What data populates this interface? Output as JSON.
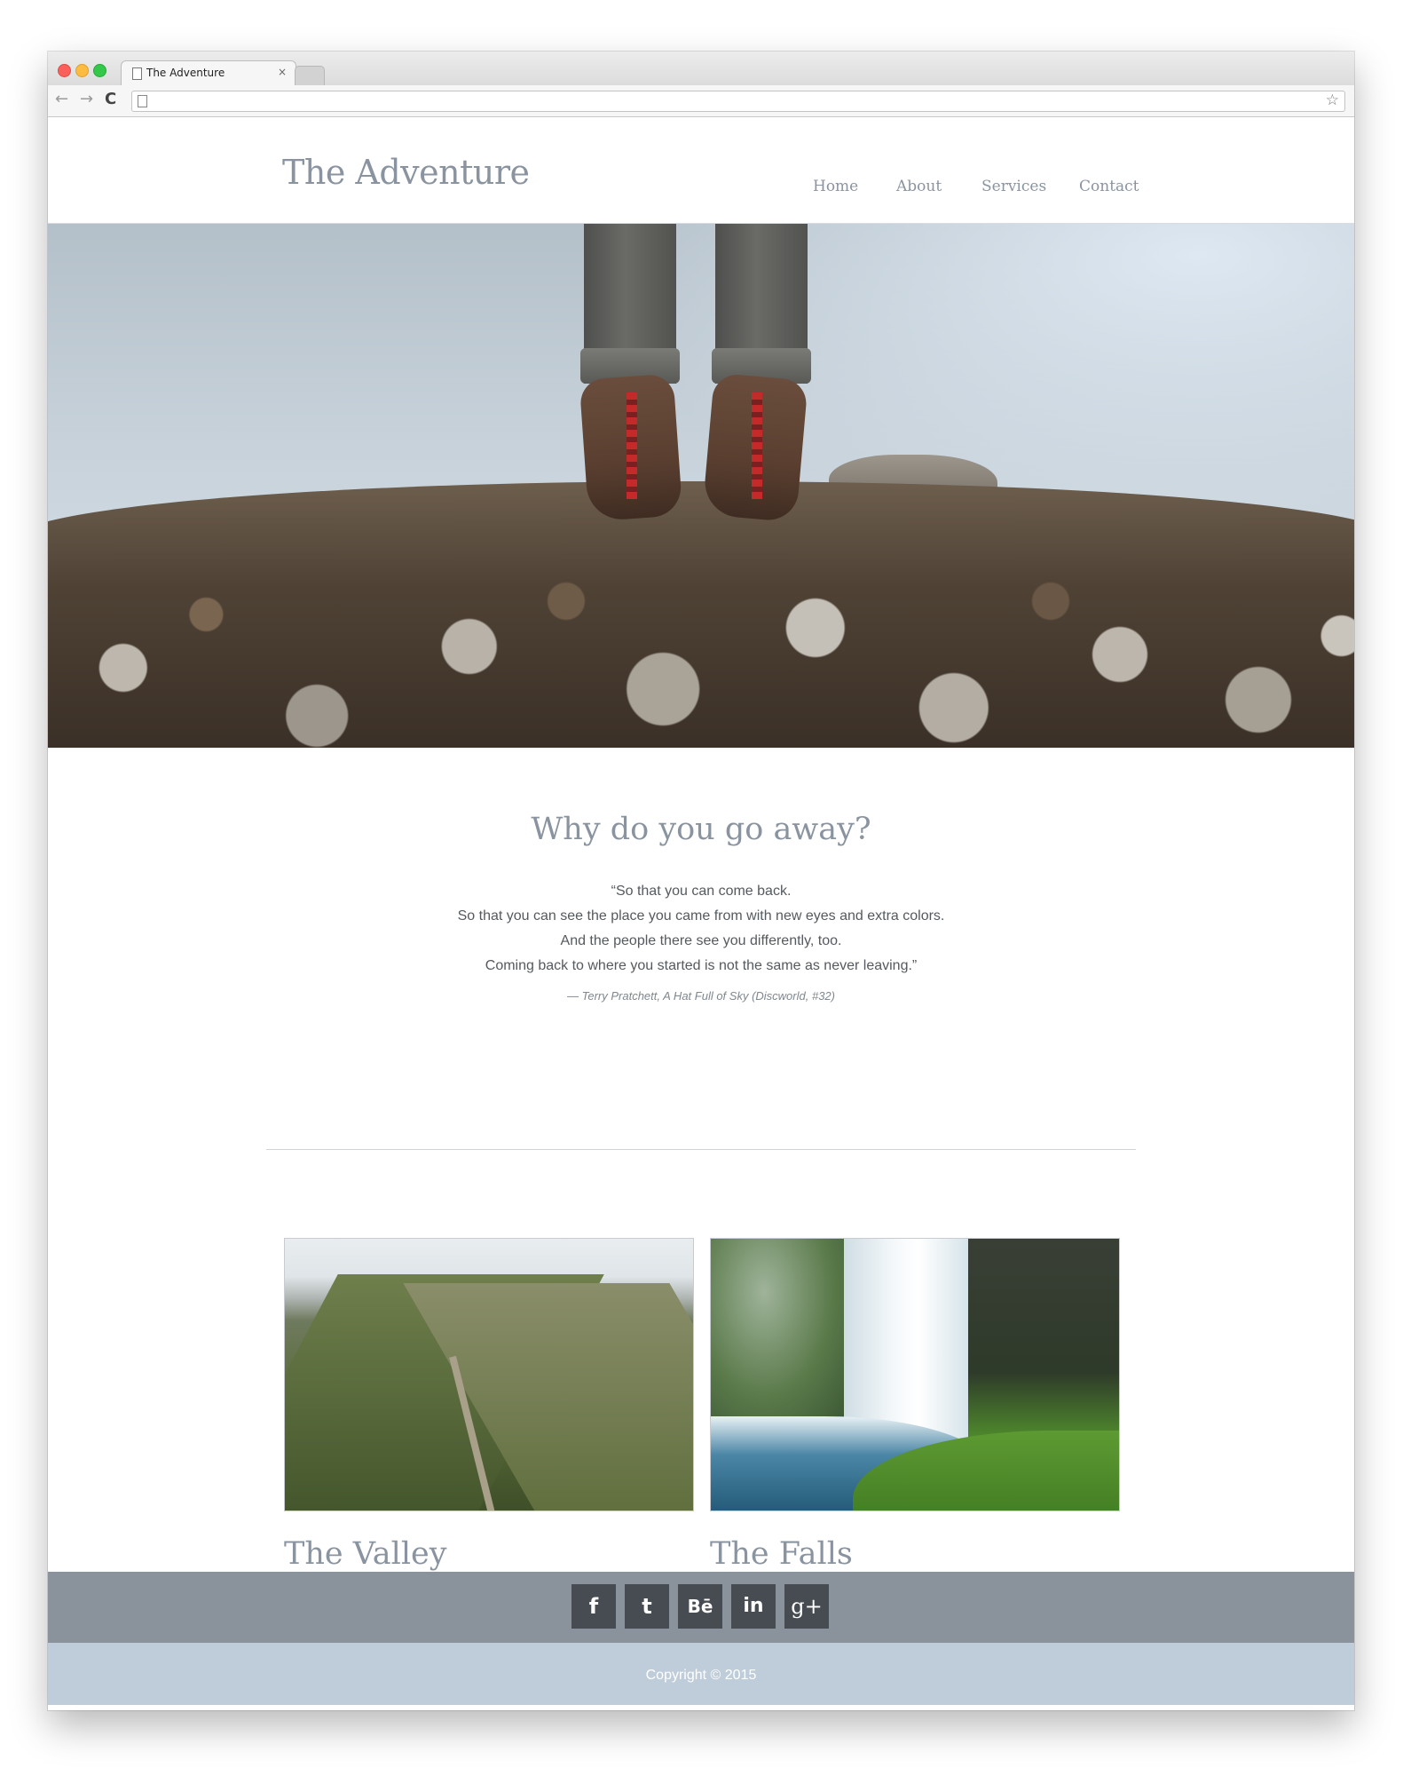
{
  "browser": {
    "tab_title": "The Adventure",
    "tab_close": "×",
    "back_icon": "←",
    "forward_icon": "→",
    "reload_icon": "C",
    "bookmark_icon": "☆"
  },
  "site": {
    "title": "The Adventure"
  },
  "nav": {
    "items": [
      {
        "label": "Home"
      },
      {
        "label": "About"
      },
      {
        "label": "Services"
      },
      {
        "label": "Contact"
      }
    ]
  },
  "quote": {
    "heading": "Why do you go away?",
    "lines": [
      "“So that you can come back.",
      "So that you can see the place you came from with new eyes and extra colors.",
      "And the people there see you differently, too.",
      "Coming back to where you started is not the same as never leaving.”"
    ],
    "citation": "— Terry Pratchett, A Hat Full of Sky (Discworld, #32)"
  },
  "cards": [
    {
      "title": "The Valley"
    },
    {
      "title": "The Falls"
    }
  ],
  "social": [
    {
      "icon": "facebook-icon",
      "glyph": "f"
    },
    {
      "icon": "twitter-icon",
      "glyph": "t"
    },
    {
      "icon": "behance-icon",
      "glyph": "Bē"
    },
    {
      "icon": "linkedin-icon",
      "glyph": "in"
    },
    {
      "icon": "google-plus-icon",
      "glyph": "g+"
    }
  ],
  "footer": {
    "copyright": "Copyright © 2015"
  },
  "colors": {
    "heading": "#8a94a0",
    "social_bar": "#8a929c",
    "social_icon_bg": "#474c52",
    "copyright_bar": "#bfccd9"
  }
}
